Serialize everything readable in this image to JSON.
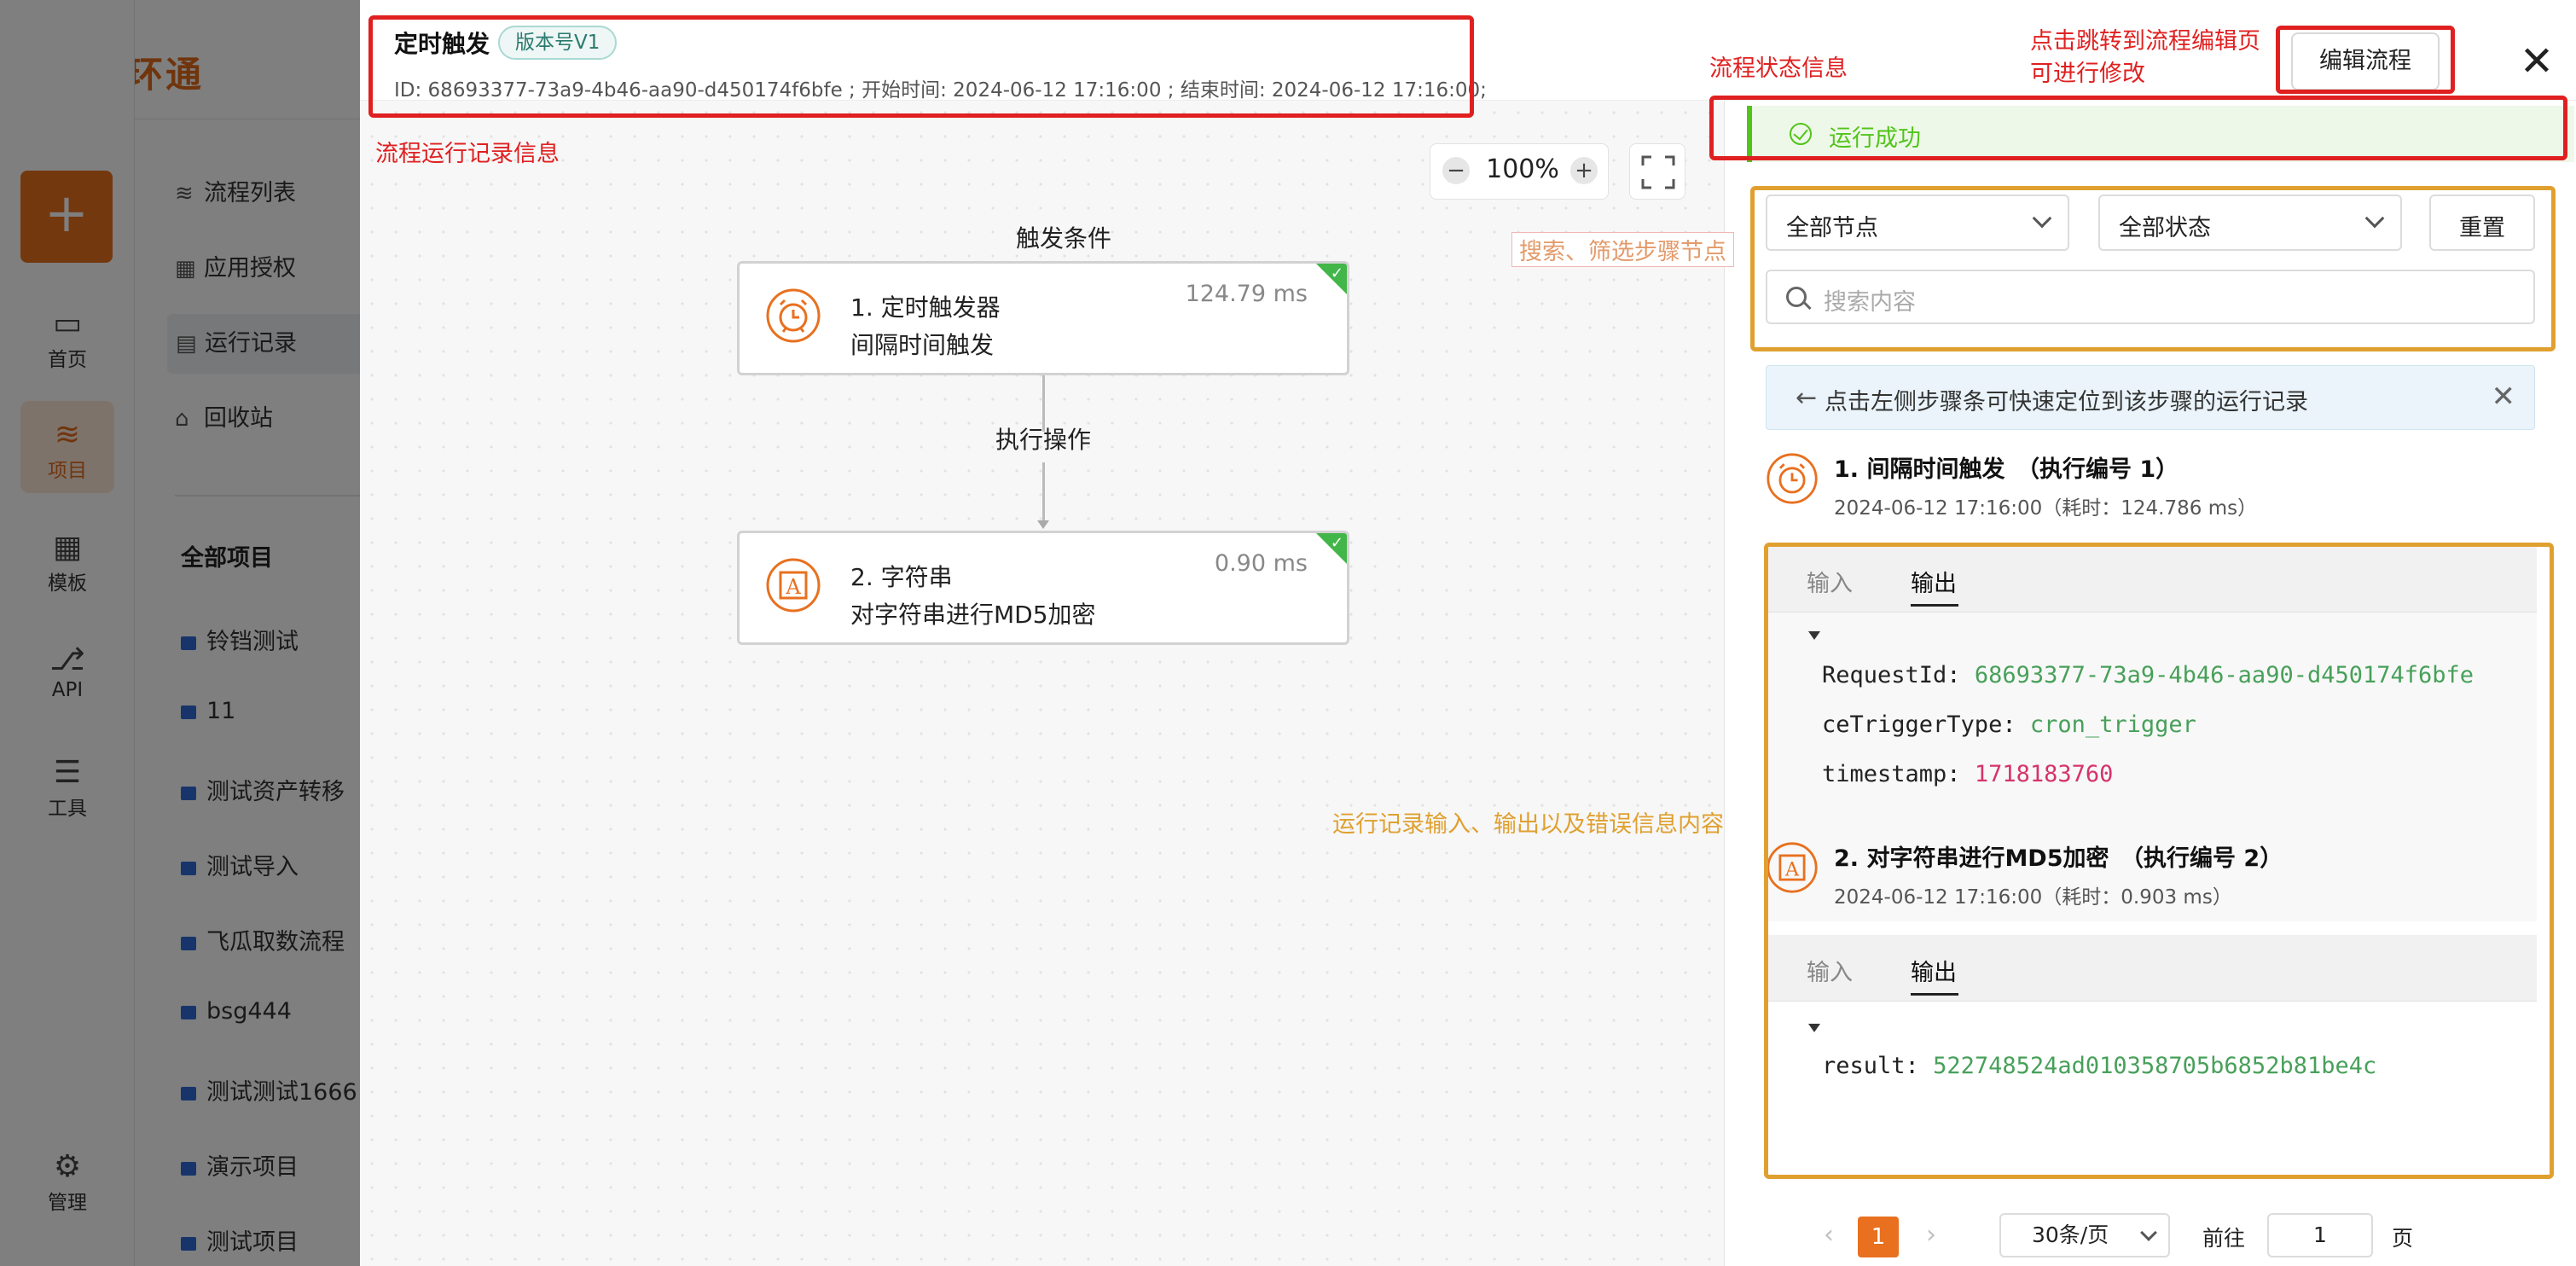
{
  "app": {
    "logo_text": "数环通",
    "add_symbol": "+",
    "rail": [
      {
        "label": "首页",
        "icon": "monitor-icon"
      },
      {
        "label": "项目",
        "icon": "layers-icon"
      },
      {
        "label": "模板",
        "icon": "grid-icon"
      },
      {
        "label": "API",
        "icon": "api-icon"
      },
      {
        "label": "工具",
        "icon": "sliders-icon"
      },
      {
        "label": "管理",
        "icon": "gear-icon"
      }
    ],
    "subnav": [
      {
        "label": "流程列表",
        "icon": "layers-icon"
      },
      {
        "label": "应用授权",
        "icon": "grid-icon"
      },
      {
        "label": "运行记录",
        "icon": "clipboard-icon"
      },
      {
        "label": "回收站",
        "icon": "trash-icon"
      }
    ],
    "projects_heading": "全部项目",
    "projects": [
      "铃铛测试",
      "11",
      "测试资产转移",
      "测试导入",
      "飞瓜取数流程",
      "bsg444",
      "测试测试1666",
      "演示项目",
      "测试项目"
    ]
  },
  "drawer": {
    "title": "定时触发",
    "version": "版本号V1",
    "meta": "ID: 68693377-73a9-4b46-aa90-d450174f6bfe ;   开始时间: 2024-06-12 17:16:00 ;   结束时间: 2024-06-12 17:16:00;",
    "edit_button": "编辑流程",
    "close_symbol": "✕"
  },
  "canvas": {
    "zoom_minus": "−",
    "zoom_value": "100%",
    "zoom_plus": "+",
    "trigger_label": "触发条件",
    "action_label": "执行操作",
    "nodes": [
      {
        "name": "1. 定时触发器",
        "desc": "间隔时间触发",
        "time": "124.79 ms",
        "icon": "alarm-clock-icon"
      },
      {
        "name": "2. 字符串",
        "desc": "对字符串进行MD5加密",
        "time": "0.90 ms",
        "icon": "text-a-icon"
      }
    ]
  },
  "panel": {
    "status": "运行成功",
    "node_filter": "全部节点",
    "status_filter": "全部状态",
    "reset_button": "重置",
    "search_placeholder": "搜索内容",
    "tip": "点击左侧步骤条可快速定位到该步骤的运行记录",
    "tip_arrow": "←",
    "tip_close": "✕",
    "steps": [
      {
        "title": "1. 间隔时间触发　（执行编号 1）",
        "time": "2024-06-12 17:16:00（耗时：124.786 ms）",
        "tab_input": "输入",
        "tab_output": "输出",
        "output": [
          {
            "key": "RequestId:",
            "value": "68693377-73a9-4b46-aa90-d450174f6bfe",
            "kind": "str"
          },
          {
            "key": "ceTriggerType:",
            "value": "cron_trigger",
            "kind": "str"
          },
          {
            "key": "timestamp:",
            "value": "1718183760",
            "kind": "num"
          }
        ]
      },
      {
        "title": "2. 对字符串进行MD5加密　（执行编号 2）",
        "time": "2024-06-12 17:16:00（耗时：0.903 ms）",
        "tab_input": "输入",
        "tab_output": "输出",
        "output": [
          {
            "key": "result:",
            "value": "522748524ad010358705b6852b81be4c",
            "kind": "str"
          }
        ]
      }
    ],
    "pagination": {
      "prev": "‹",
      "current": "1",
      "next": "›",
      "page_size": "30条/页",
      "goto_label": "前往",
      "goto_value": "1",
      "page_label": "页"
    }
  },
  "annotations": {
    "record_info": "流程运行记录信息",
    "status_info": "流程状态信息",
    "edit_hint_line1": "点击跳转到流程编辑页",
    "edit_hint_line2": "可进行修改",
    "filter_hint": "搜索、筛选步骤节点",
    "content_hint": "运行记录输入、输出以及错误信息内容"
  },
  "colors": {
    "brand": "#e06a1b",
    "success": "#52c41a",
    "annotation_red": "#e02020",
    "annotation_orange": "#e0a030",
    "json_string": "#48a05a",
    "json_number": "#d6336c"
  }
}
